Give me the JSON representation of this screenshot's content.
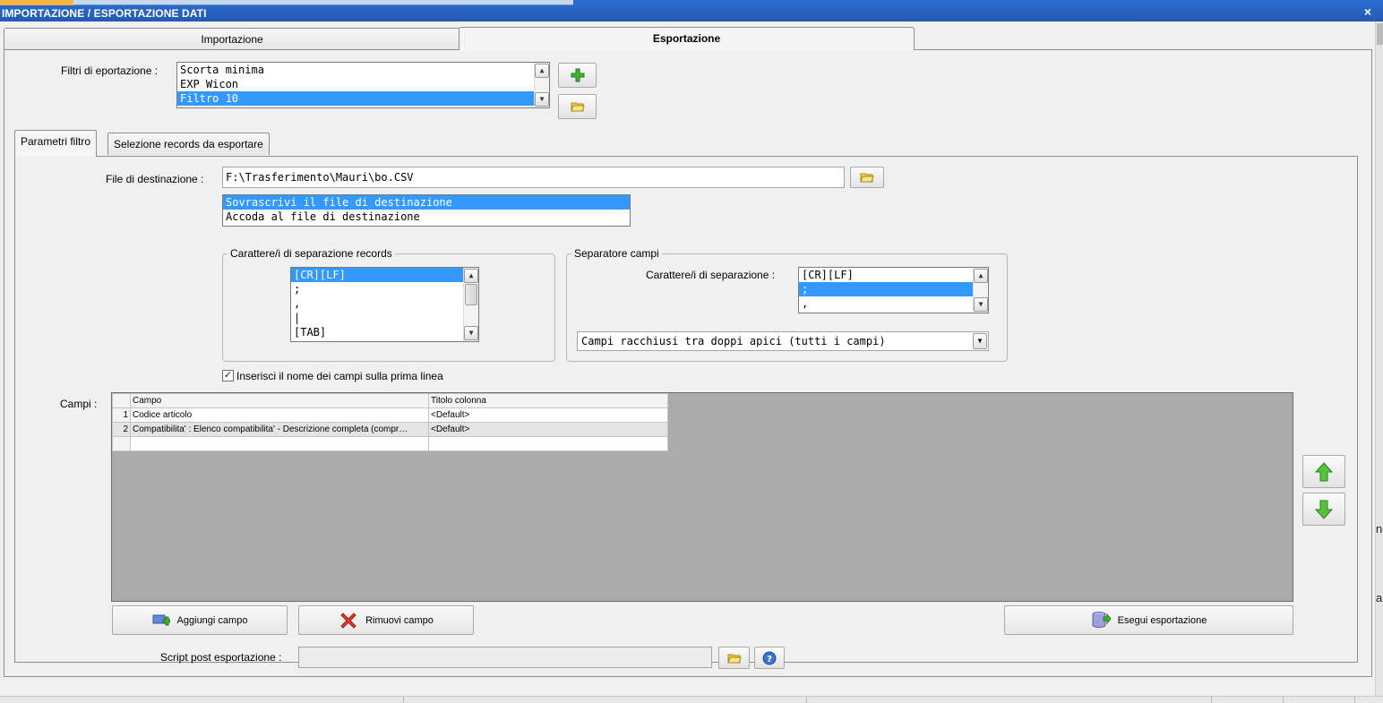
{
  "window": {
    "title": "IMPORTAZIONE / ESPORTAZIONE DATI",
    "close_glyph": "×"
  },
  "main_tabs": [
    {
      "label": "Importazione"
    },
    {
      "label": "Esportazione"
    }
  ],
  "filters": {
    "label": "Filtri di eportazione :",
    "items": [
      "Scorta minima",
      "EXP Wicon",
      "Filtro 10"
    ],
    "selected": "Filtro 10"
  },
  "sub_tabs": [
    {
      "label": "Parametri filtro"
    },
    {
      "label": "Selezione records da esportare"
    }
  ],
  "destination": {
    "label": "File di destinazione :",
    "value": "F:\\Trasferimento\\Mauri\\bo.CSV",
    "mode_options": [
      "Sovrascrivi il file di destinazione",
      "Accoda al file di destinazione"
    ],
    "mode_selected": "Sovrascrivi il file di destinazione"
  },
  "record_separator": {
    "title": "Carattere/i di separazione records",
    "items": [
      "[CR][LF]",
      ";",
      ",",
      "|",
      "[TAB]"
    ],
    "selected": "[CR][LF]"
  },
  "field_separator": {
    "title": "Separatore campi",
    "label": "Carattere/i di separazione :",
    "items": [
      "[CR][LF]",
      ";",
      ","
    ],
    "selected": ";",
    "quote_mode": "Campi racchiusi tra doppi apici (tutti i campi)"
  },
  "header_checkbox": {
    "label": "Inserisci il nome dei campi sulla prima linea",
    "checked": true,
    "mark": "✓"
  },
  "fields": {
    "label": "Campi :",
    "columns": [
      "Campo",
      "Titolo colonna"
    ],
    "rows": [
      {
        "num": "1",
        "campo": "Codice articolo",
        "titolo": "<Default>"
      },
      {
        "num": "2",
        "campo": "Compatibilita' : Elenco compatibilita' - Descrizione completa (compr…",
        "titolo": "<Default>"
      }
    ]
  },
  "buttons": {
    "add_field": "Aggiungi campo",
    "remove_field": "Rimuovi campo",
    "run_export": "Esegui esportazione"
  },
  "script": {
    "label": "Script post esportazione :",
    "value": ""
  },
  "clipped_side_text": [
    "ne",
    "a"
  ],
  "colors": {
    "title_bar": "#2459b4",
    "selection": "#3399ff",
    "grid_bg": "#ababab"
  }
}
